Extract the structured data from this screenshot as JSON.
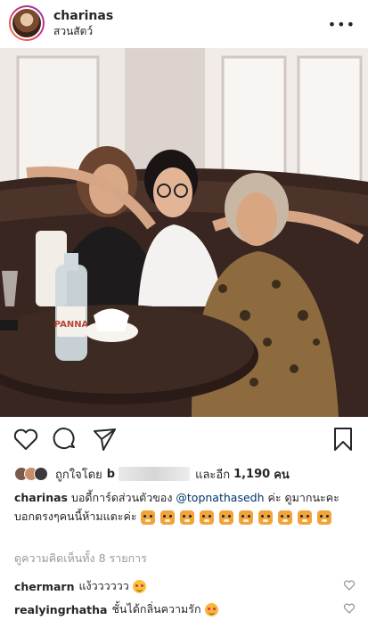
{
  "header": {
    "username": "charinas",
    "location": "สวนสัตว์",
    "more_label": "•••"
  },
  "photo": {
    "bottle_label": "PANNA"
  },
  "actions": {
    "icons": [
      "heart-icon",
      "comment-icon",
      "share-icon",
      "bookmark-icon"
    ]
  },
  "likes": {
    "prefix": "ถูกใจโดย",
    "visible_name_start": "b",
    "suffix": "และอีก",
    "count": "1,190",
    "unit": "คน"
  },
  "caption": {
    "username": "charinas",
    "text_before": "บอดี้การ์ดส่วนตัวของ",
    "mention": "@topnathasedh",
    "text_after": "ค่ะ ดูมากนะคะบอกตรงๆคนนี้ห้ามแตะค่ะ"
  },
  "view_comments": "ดูความคิดเห็นทั้ง 8 รายการ",
  "comments": [
    {
      "username": "chermarn",
      "text": "แง้วววววว"
    },
    {
      "username": "realyingrhatha",
      "text": "ชั้นได้กลิ่นความรัก"
    }
  ],
  "colors": {
    "text": "#262626",
    "muted": "#999999",
    "mention": "#003569"
  }
}
